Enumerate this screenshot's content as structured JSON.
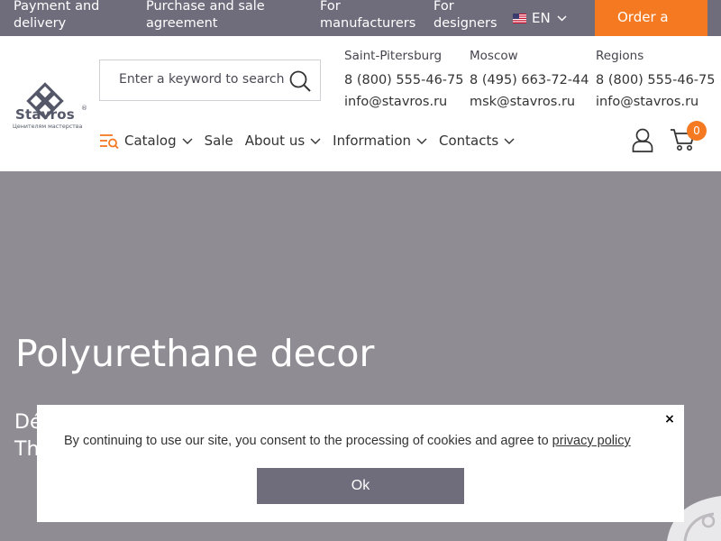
{
  "topbar": {
    "links": [
      {
        "line1": "Payment and",
        "line2": "delivery"
      },
      {
        "line1": "Purchase and sale",
        "line2": "agreement"
      },
      {
        "line1": "For",
        "line2": "manufacturers"
      },
      {
        "line1": "For",
        "line2": "designers"
      }
    ],
    "language": "EN",
    "order_label": "Order a"
  },
  "logo": {
    "name": "Stavros",
    "registered": "®",
    "tagline": "Ценителям мастерства"
  },
  "search": {
    "placeholder": "Enter a keyword to search"
  },
  "contacts": [
    {
      "city": "Saint-Pitersburg",
      "phone": "8 (800) 555-46-75",
      "email": "info@stavros.ru"
    },
    {
      "city": "Moscow",
      "phone": "8 (495) 663-72-44",
      "email": "msk@stavros.ru"
    },
    {
      "city": "Regions",
      "phone": "8 (800) 555-46-75",
      "email": "info@stavros.ru"
    }
  ],
  "nav": {
    "items": [
      {
        "label": "Catalog"
      },
      {
        "label": "Sale"
      },
      {
        "label": "About us"
      },
      {
        "label": "Information"
      },
      {
        "label": "Contacts"
      }
    ]
  },
  "cart": {
    "count": "0"
  },
  "hero": {
    "title": "Polyurethane decor",
    "sub1": "Dé",
    "sub2": "Th"
  },
  "cookie": {
    "message": "By continuing to use our site, you consent to the processing of cookies and agree to ",
    "link": "privacy policy",
    "ok_label": "Ok",
    "close": "×"
  },
  "colors": {
    "accent": "#f47920",
    "topbar": "#6f6c7c",
    "hero_bg": "#8f8d93"
  }
}
